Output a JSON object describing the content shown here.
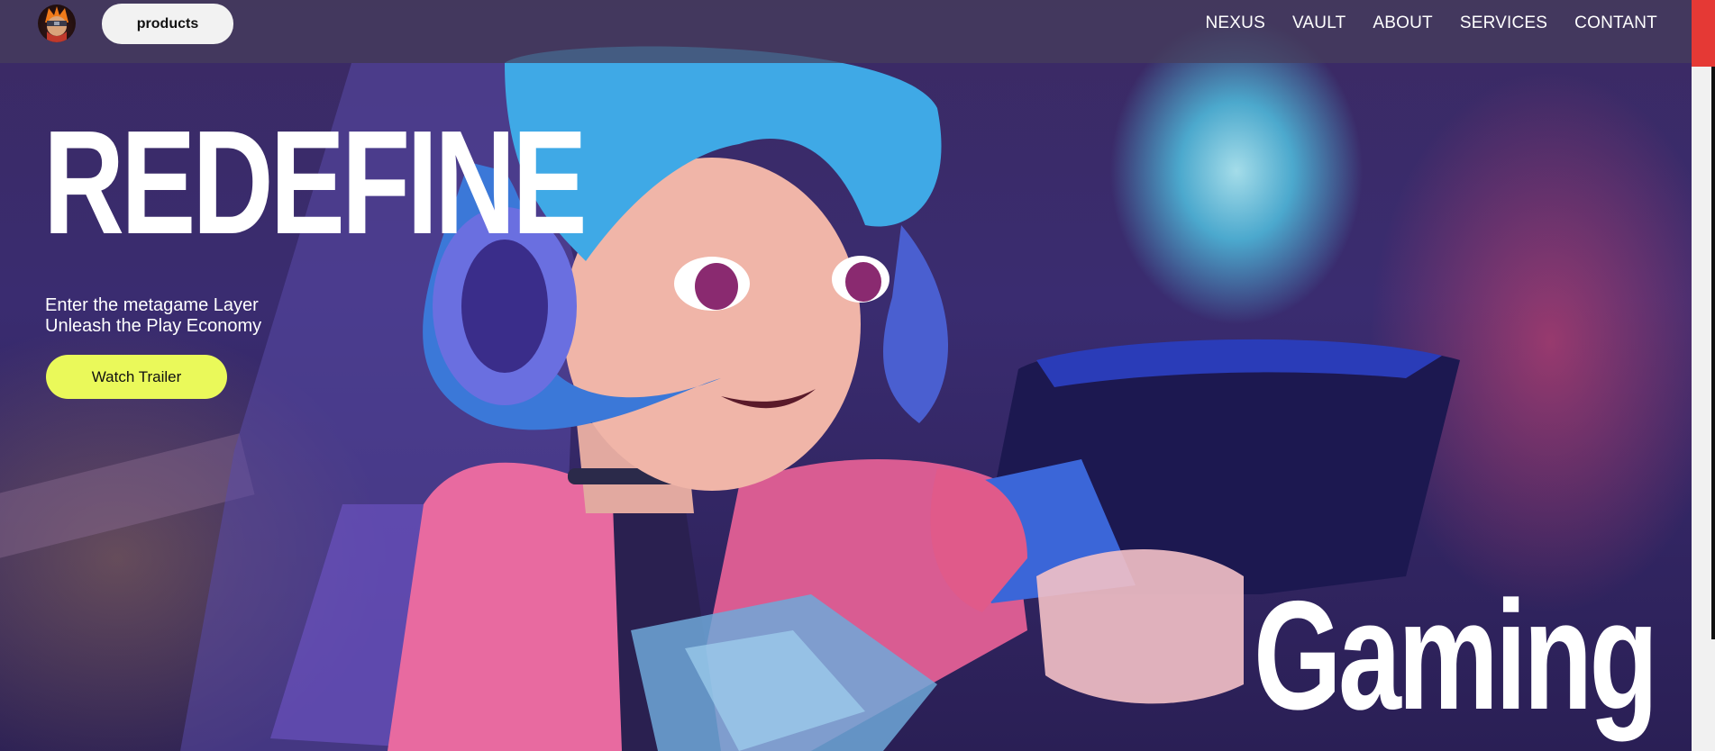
{
  "header": {
    "products_label": "products",
    "nav": [
      "NEXUS",
      "VAULT",
      "ABOUT",
      "SERVICES",
      "CONTANT"
    ],
    "logo_icon": "ninja-avatar-icon"
  },
  "hero": {
    "headline": "REDEFINE",
    "tagline_line1": "Enter the metagame Layer",
    "tagline_line2": "Unleash the Play Economy",
    "cta_label": "Watch Trailer",
    "corner_word": "Gaming",
    "background_art": "anime-gamer-girl-artwork"
  },
  "colors": {
    "cta": "#eaf95a",
    "products_button": "#f2f2f2",
    "scroll_thumb": "#e53935",
    "topbar": "#463e5c"
  }
}
